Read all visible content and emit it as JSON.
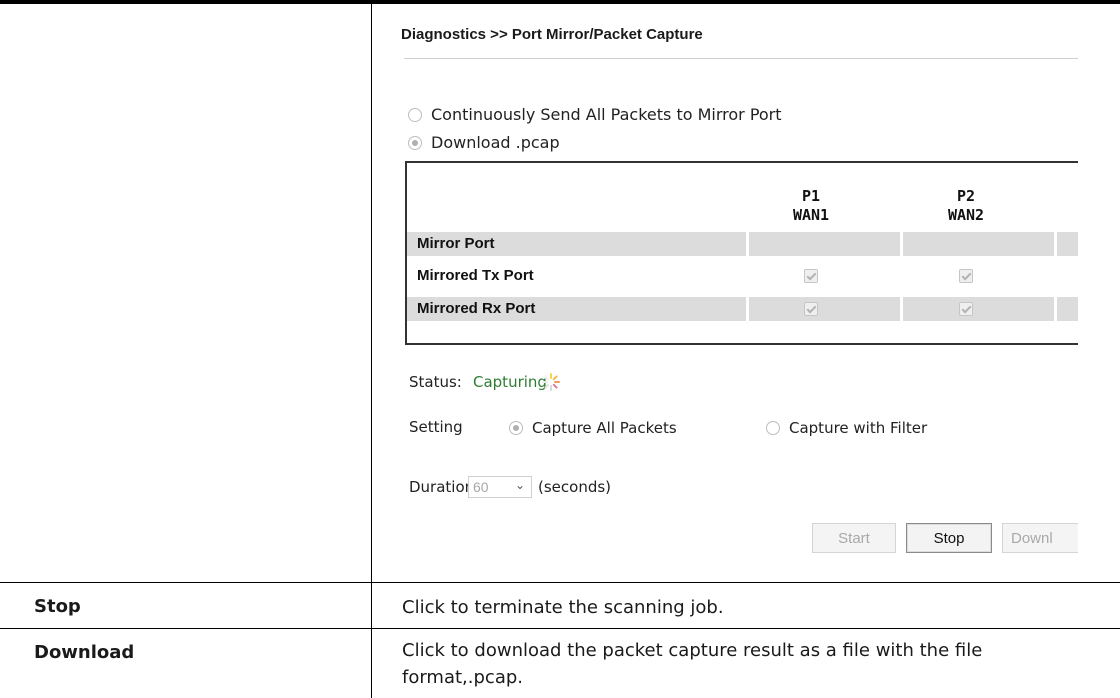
{
  "screenshot": {
    "title": "Diagnostics >> Port Mirror/Packet Capture",
    "mode_options": [
      {
        "label": "Continuously Send All Packets to Mirror Port",
        "selected": false
      },
      {
        "label": "Download .pcap",
        "selected": true
      }
    ],
    "ports": [
      {
        "id": "P1",
        "name": "WAN1"
      },
      {
        "id": "P2",
        "name": "WAN2"
      }
    ],
    "port_rows": [
      {
        "label": "Mirror Port"
      },
      {
        "label": "Mirrored Tx Port",
        "p1_checked": true,
        "p2_checked": true
      },
      {
        "label": "Mirrored Rx Port",
        "p1_checked": true,
        "p2_checked": true
      }
    ],
    "status": {
      "label": "Status:",
      "value": "Capturing",
      "value_color": "#2e7d32"
    },
    "setting": {
      "label": "Setting",
      "options": [
        {
          "label": "Capture All Packets",
          "selected": true
        },
        {
          "label": "Capture with Filter",
          "selected": false
        }
      ]
    },
    "duration": {
      "label": "Duration",
      "value": "60",
      "unit": "(seconds)"
    },
    "buttons": {
      "start": "Start",
      "stop": "Stop",
      "download": "Downl"
    }
  },
  "table_rows": [
    {
      "term": "Stop",
      "description": "Click to terminate the scanning job."
    },
    {
      "term": "Download",
      "description": "Click to download the packet capture result as a file with the file format,.pcap."
    }
  ]
}
